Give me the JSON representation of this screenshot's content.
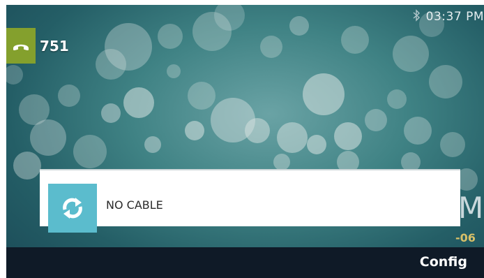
{
  "status_bar": {
    "bluetooth_icon": "bluetooth-icon",
    "time": "03:37 PM"
  },
  "line_key": {
    "icon": "phone-handset-icon",
    "icon_color": "#84a02d",
    "label": "751"
  },
  "idle_clock": {
    "partial_text": "M",
    "partial_date": "-06"
  },
  "notification": {
    "icon": "refresh-icon",
    "icon_color": "#5bbccd",
    "text": "NO CABLE"
  },
  "softkeys": {
    "config_label": "Config"
  }
}
